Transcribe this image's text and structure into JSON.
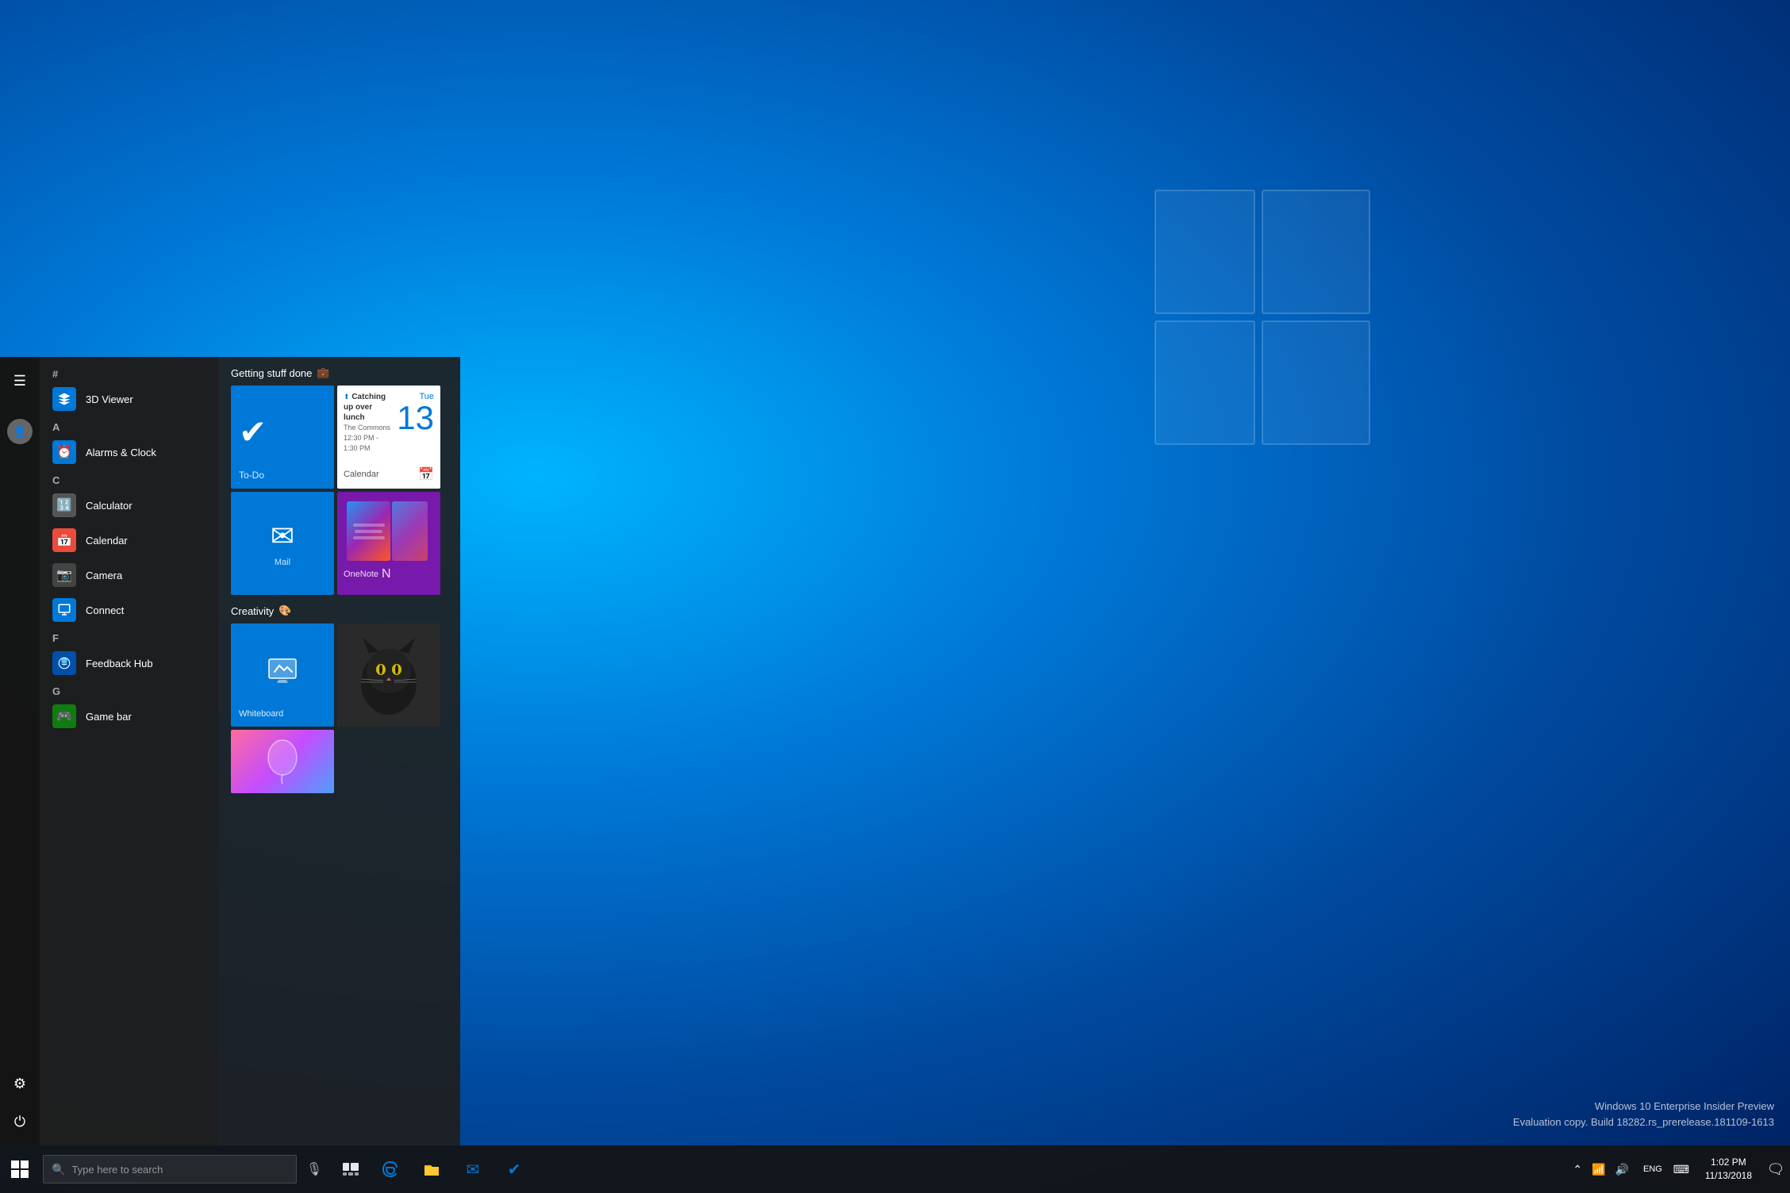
{
  "desktop": {
    "background": "Windows 10 blue gradient desktop"
  },
  "start_menu": {
    "sidebar_icons": [
      {
        "name": "hamburger",
        "icon": "☰",
        "label": "Expand"
      },
      {
        "name": "user",
        "icon": "👤",
        "label": "User"
      }
    ],
    "settings_icon": "⚙",
    "power_icon": "⏻",
    "sections": [
      {
        "letter": "#",
        "apps": [
          {
            "name": "3D Viewer",
            "icon": "🎲",
            "color": "#0078d7"
          }
        ]
      },
      {
        "letter": "A",
        "apps": [
          {
            "name": "Alarms & Clock",
            "icon": "⏰",
            "color": "#0078d7"
          }
        ]
      },
      {
        "letter": "C",
        "apps": [
          {
            "name": "Calculator",
            "icon": "🔢",
            "color": "#555"
          },
          {
            "name": "Calendar",
            "icon": "📅",
            "color": "#e74c3c"
          },
          {
            "name": "Camera",
            "icon": "📷",
            "color": "#333"
          },
          {
            "name": "Connect",
            "icon": "🖥",
            "color": "#0078d7"
          }
        ]
      },
      {
        "letter": "F",
        "apps": [
          {
            "name": "Feedback Hub",
            "icon": "💬",
            "color": "#0050aa"
          }
        ]
      },
      {
        "letter": "G",
        "apps": [
          {
            "name": "Game bar",
            "icon": "🎮",
            "color": "#107c10"
          }
        ]
      }
    ],
    "tiles": {
      "section1": {
        "title": "Getting stuff done",
        "icon": "💼",
        "items": [
          {
            "type": "todo",
            "label": "To-Do",
            "event": "Catching up over lunch",
            "location": "The Commons",
            "time": "12:30 PM - 1:30 PM",
            "weekday": "Tue",
            "day": "13",
            "calendar_label": "Calendar"
          },
          {
            "type": "mail",
            "label": "Mail"
          },
          {
            "type": "onenote",
            "label": "OneNote"
          }
        ]
      },
      "section2": {
        "title": "Creativity",
        "icon": "🌟",
        "items": [
          {
            "type": "whiteboard",
            "label": "Whiteboard"
          },
          {
            "type": "photo",
            "label": "Cat photo"
          }
        ]
      }
    }
  },
  "taskbar": {
    "start_label": "Start",
    "search_placeholder": "Type here to search",
    "apps": [
      {
        "name": "Edge",
        "icon": "e",
        "color": "#0078d7"
      },
      {
        "name": "File Explorer",
        "icon": "📁",
        "color": "#ffb900"
      },
      {
        "name": "Mail",
        "icon": "✉",
        "color": "#0078d7"
      },
      {
        "name": "To-Do",
        "icon": "✔",
        "color": "#0078d7"
      }
    ],
    "system": {
      "time": "1:02 PM",
      "date": "11/13/2018",
      "language": "ENG"
    }
  },
  "watermark": {
    "line1": "Windows 10 Enterprise Insider Preview",
    "line2": "Evaluation copy. Build 18282.rs_prerelease.181109-1613"
  }
}
